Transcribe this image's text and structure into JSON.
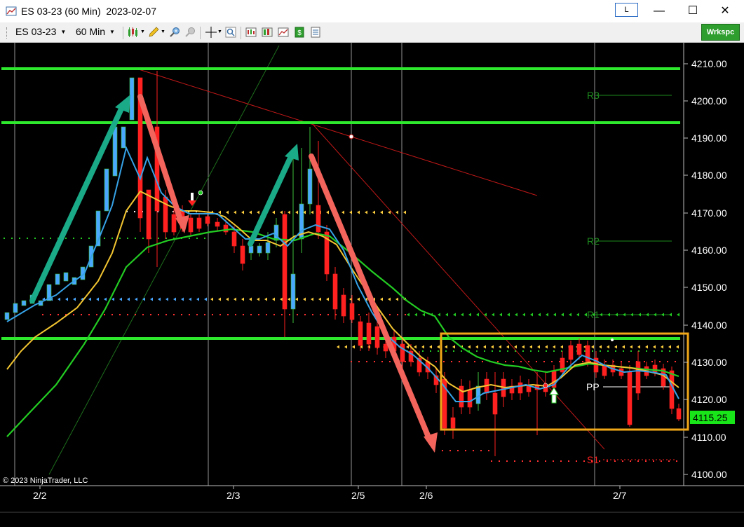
{
  "window": {
    "title": "ES 03-23 (60 Min)  2023-02-07",
    "link_label": "L",
    "minimize_label": "—",
    "maximize_label": "☐",
    "close_label": "✕"
  },
  "toolbar": {
    "instrument": "ES 03-23",
    "interval": "60 Min",
    "workspace_label": "Wrkspc",
    "icons": [
      "bar-type-icon",
      "drawing-tools-icon",
      "zoom-in-icon",
      "zoom-out-icon",
      "crosshair-icon",
      "magnify-icon",
      "indicators-icon",
      "strategies-icon",
      "chart-properties-icon",
      "order-entry-icon",
      "data-box-icon"
    ]
  },
  "chart": {
    "copyright": "© 2023 NinjaTrader, LLC",
    "price_labels": [
      "4210.00",
      "4200.00",
      "4190.00",
      "4180.00",
      "4170.00",
      "4160.00",
      "4150.00",
      "4140.00",
      "4130.00",
      "4120.00",
      "4110.00",
      "4100.00"
    ],
    "date_labels": [
      "2/2",
      "2/3",
      "2/5",
      "2/6",
      "2/7"
    ],
    "pivot_labels": [
      "R3",
      "R2",
      "R1",
      "PP",
      "S1"
    ],
    "last_price": "4115.25",
    "colors": {
      "background": "#000000",
      "up_candle": "#4aa8ff",
      "down_candle": "#ff2020",
      "ema_fast": "#36a3e8",
      "ema_mid": "#f2c531",
      "ema_slow": "#23cc23",
      "support_resistance": "#2ee82e",
      "arrow_up": "#1aaa88",
      "arrow_down": "#f2645c",
      "highlight_box": "#f0a818",
      "price_marker_bg": "#19e619"
    }
  }
}
